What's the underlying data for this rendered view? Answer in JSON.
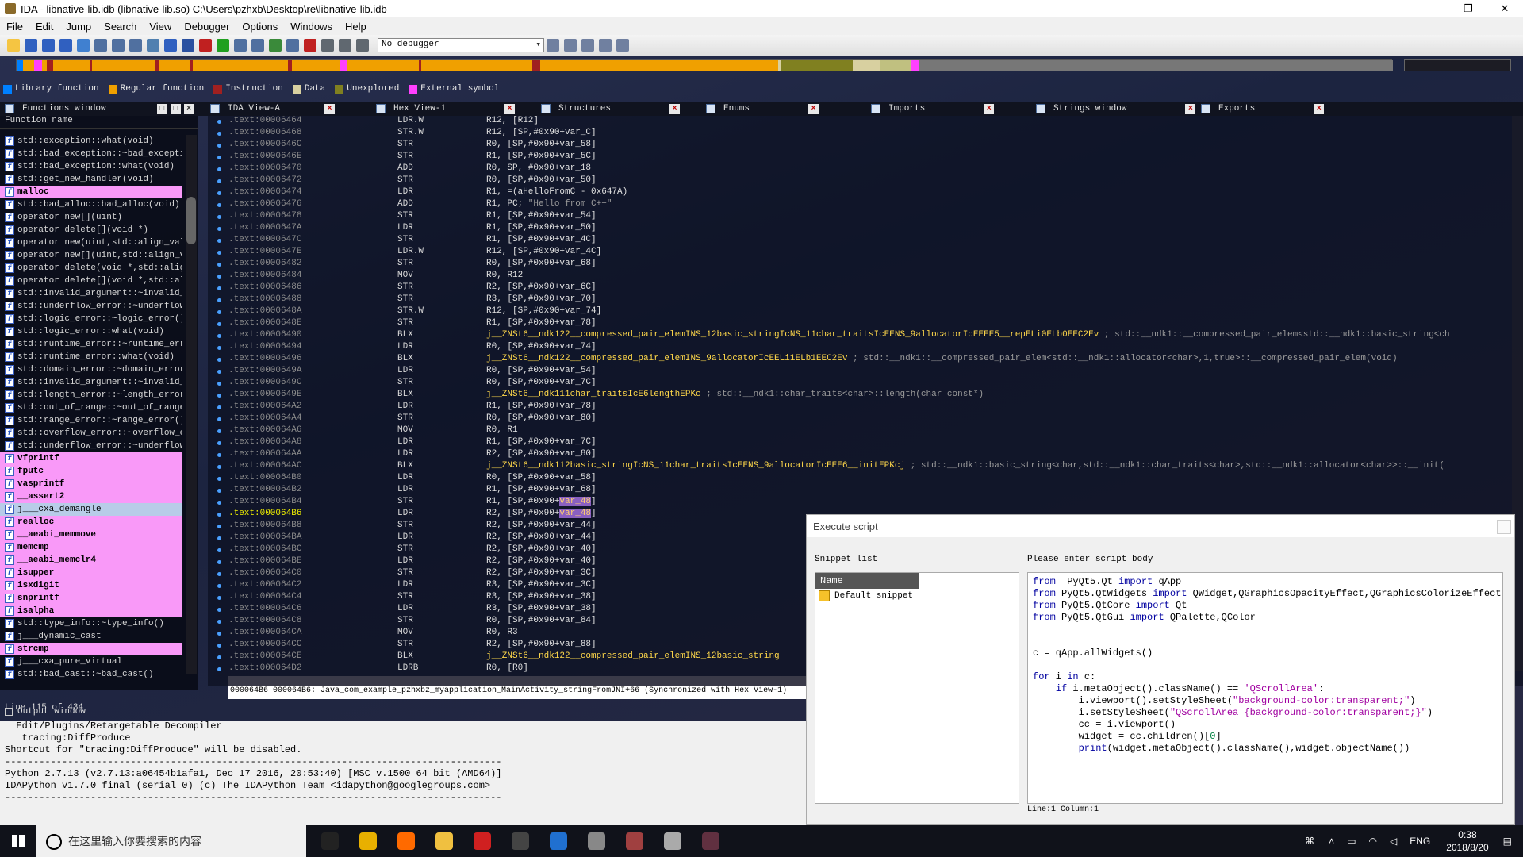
{
  "window": {
    "title": "IDA - libnative-lib.idb (libnative-lib.so) C:\\Users\\pzhxb\\Desktop\\re\\libnative-lib.idb",
    "min": "—",
    "max": "❐",
    "close": "✕"
  },
  "menu": [
    "File",
    "Edit",
    "Jump",
    "Search",
    "View",
    "Debugger",
    "Options",
    "Windows",
    "Help"
  ],
  "debugger_select": "No debugger",
  "legend": [
    {
      "label": "Library function",
      "color": "#0080ff"
    },
    {
      "label": "Regular function",
      "color": "#f0a000"
    },
    {
      "label": "Instruction",
      "color": "#a02020"
    },
    {
      "label": "Data",
      "color": "#d8d0a0"
    },
    {
      "label": "Unexplored",
      "color": "#808020"
    },
    {
      "label": "External symbol",
      "color": "#ff40ff"
    }
  ],
  "tabs": [
    {
      "label": "Functions window"
    },
    {
      "label": "IDA View-A"
    },
    {
      "label": "Hex View-1"
    },
    {
      "label": "Structures"
    },
    {
      "label": "Enums"
    },
    {
      "label": "Imports"
    },
    {
      "label": "Strings window"
    },
    {
      "label": "Exports"
    }
  ],
  "functions_window": {
    "header": "Function name",
    "rows": [
      {
        "name": "std::exception::what(void)",
        "style": ""
      },
      {
        "name": "std::bad_exception::~bad_exception",
        "style": ""
      },
      {
        "name": "std::bad_exception::what(void)",
        "style": ""
      },
      {
        "name": "std::get_new_handler(void)",
        "style": ""
      },
      {
        "name": "malloc",
        "style": "pink"
      },
      {
        "name": "std::bad_alloc::bad_alloc(void)",
        "style": ""
      },
      {
        "name": "operator new[](uint)",
        "style": ""
      },
      {
        "name": "operator delete[](void *)",
        "style": ""
      },
      {
        "name": "operator new(uint,std::align_val_t",
        "style": ""
      },
      {
        "name": "operator new[](uint,std::align_val",
        "style": ""
      },
      {
        "name": "operator delete(void *,std::align_",
        "style": ""
      },
      {
        "name": "operator delete[](void *,std::alig",
        "style": ""
      },
      {
        "name": "std::invalid_argument::~invalid_ar",
        "style": ""
      },
      {
        "name": "std::underflow_error::~underflow_e",
        "style": ""
      },
      {
        "name": "std::logic_error::~logic_error()",
        "style": ""
      },
      {
        "name": "std::logic_error::what(void)",
        "style": ""
      },
      {
        "name": "std::runtime_error::~runtime_error",
        "style": ""
      },
      {
        "name": "std::runtime_error::what(void)",
        "style": ""
      },
      {
        "name": "std::domain_error::~domain_error()",
        "style": ""
      },
      {
        "name": "std::invalid_argument::~invalid_ar",
        "style": ""
      },
      {
        "name": "std::length_error::~length_error()",
        "style": ""
      },
      {
        "name": "std::out_of_range::~out_of_range()",
        "style": ""
      },
      {
        "name": "std::range_error::~range_error()",
        "style": ""
      },
      {
        "name": "std::overflow_error::~overflow_err",
        "style": ""
      },
      {
        "name": "std::underflow_error::~underflow_e",
        "style": ""
      },
      {
        "name": "vfprintf",
        "style": "pink"
      },
      {
        "name": "fputc",
        "style": "pink"
      },
      {
        "name": "vasprintf",
        "style": "pink"
      },
      {
        "name": "__assert2",
        "style": "pink"
      },
      {
        "name": "j___cxa_demangle",
        "style": "sel"
      },
      {
        "name": "realloc",
        "style": "pink"
      },
      {
        "name": "__aeabi_memmove",
        "style": "pink"
      },
      {
        "name": "memcmp",
        "style": "pink"
      },
      {
        "name": "__aeabi_memclr4",
        "style": "pink"
      },
      {
        "name": "isupper",
        "style": "pink"
      },
      {
        "name": "isxdigit",
        "style": "pink"
      },
      {
        "name": "snprintf",
        "style": "pink"
      },
      {
        "name": "isalpha",
        "style": "pink"
      },
      {
        "name": "std::type_info::~type_info()",
        "style": ""
      },
      {
        "name": "j___dynamic_cast",
        "style": ""
      },
      {
        "name": "strcmp",
        "style": "pink"
      },
      {
        "name": "j___cxa_pure_virtual",
        "style": ""
      },
      {
        "name": "std::bad_cast::~bad_cast()",
        "style": ""
      }
    ],
    "footer": "Line 115 of 434"
  },
  "disasm": [
    {
      "addr": ".text:00006464",
      "mn": "LDR.W",
      "ops": "R12, [R12]"
    },
    {
      "addr": ".text:00006468",
      "mn": "STR.W",
      "ops": "R12, [SP,#0x90+var_C]"
    },
    {
      "addr": ".text:0000646C",
      "mn": "STR",
      "ops": "R0, [SP,#0x90+var_58]"
    },
    {
      "addr": ".text:0000646E",
      "mn": "STR",
      "ops": "R1, [SP,#0x90+var_5C]"
    },
    {
      "addr": ".text:00006470",
      "mn": "ADD",
      "ops": "R0, SP, #0x90+var_18"
    },
    {
      "addr": ".text:00006472",
      "mn": "STR",
      "ops": "R0, [SP,#0x90+var_50]"
    },
    {
      "addr": ".text:00006474",
      "mn": "LDR",
      "ops": "R1, =(aHelloFromC - 0x647A)"
    },
    {
      "addr": ".text:00006476",
      "mn": "ADD",
      "ops": "R1, PC",
      "cm": "; \"Hello from C++\""
    },
    {
      "addr": ".text:00006478",
      "mn": "STR",
      "ops": "R1, [SP,#0x90+var_54]"
    },
    {
      "addr": ".text:0000647A",
      "mn": "LDR",
      "ops": "R1, [SP,#0x90+var_50]"
    },
    {
      "addr": ".text:0000647C",
      "mn": "STR",
      "ops": "R1, [SP,#0x90+var_4C]"
    },
    {
      "addr": ".text:0000647E",
      "mn": "LDR.W",
      "ops": "R12, [SP,#0x90+var_4C]"
    },
    {
      "addr": ".text:00006482",
      "mn": "STR",
      "ops": "R0, [SP,#0x90+var_68]"
    },
    {
      "addr": ".text:00006484",
      "mn": "MOV",
      "ops": "R0, R12"
    },
    {
      "addr": ".text:00006486",
      "mn": "STR",
      "ops": "R2, [SP,#0x90+var_6C]"
    },
    {
      "addr": ".text:00006488",
      "mn": "STR",
      "ops": "R3, [SP,#0x90+var_70]"
    },
    {
      "addr": ".text:0000648A",
      "mn": "STR.W",
      "ops": "R12, [SP,#0x90+var_74]"
    },
    {
      "addr": ".text:0000648E",
      "mn": "STR",
      "ops": "R1, [SP,#0x90+var_78]"
    },
    {
      "addr": ".text:00006490",
      "mn": "BLX",
      "fn": "j__ZNSt6__ndk122__compressed_pair_elemINS_12basic_stringIcNS_11char_traitsIcEENS_9allocatorIcEEEE5__repELi0ELb0EEC2Ev",
      "cm": " ; std::__ndk1::__compressed_pair_elem<std::__ndk1::basic_string<ch"
    },
    {
      "addr": ".text:00006494",
      "mn": "LDR",
      "ops": "R0, [SP,#0x90+var_74]"
    },
    {
      "addr": ".text:00006496",
      "mn": "BLX",
      "fn": "j__ZNSt6__ndk122__compressed_pair_elemINS_9allocatorIcEELi1ELb1EEC2Ev",
      "cm": " ; std::__ndk1::__compressed_pair_elem<std::__ndk1::allocator<char>,1,true>::__compressed_pair_elem(void)"
    },
    {
      "addr": ".text:0000649A",
      "mn": "LDR",
      "ops": "R0, [SP,#0x90+var_54]"
    },
    {
      "addr": ".text:0000649C",
      "mn": "STR",
      "ops": "R0, [SP,#0x90+var_7C]"
    },
    {
      "addr": ".text:0000649E",
      "mn": "BLX",
      "fn": "j__ZNSt6__ndk111char_traitsIcE6lengthEPKc",
      "cm": " ; std::__ndk1::char_traits<char>::length(char const*)"
    },
    {
      "addr": ".text:000064A2",
      "mn": "LDR",
      "ops": "R1, [SP,#0x90+var_78]"
    },
    {
      "addr": ".text:000064A4",
      "mn": "STR",
      "ops": "R0, [SP,#0x90+var_80]"
    },
    {
      "addr": ".text:000064A6",
      "mn": "MOV",
      "ops": "R0, R1"
    },
    {
      "addr": ".text:000064A8",
      "mn": "LDR",
      "ops": "R1, [SP,#0x90+var_7C]"
    },
    {
      "addr": ".text:000064AA",
      "mn": "LDR",
      "ops": "R2, [SP,#0x90+var_80]"
    },
    {
      "addr": ".text:000064AC",
      "mn": "BLX",
      "fn": "j__ZNSt6__ndk112basic_stringIcNS_11char_traitsIcEENS_9allocatorIcEEE6__initEPKcj",
      "cm": " ; std::__ndk1::basic_string<char,std::__ndk1::char_traits<char>,std::__ndk1::allocator<char>>::__init("
    },
    {
      "addr": ".text:000064B0",
      "mn": "LDR",
      "ops": "R0, [SP,#0x90+var_58]"
    },
    {
      "addr": ".text:000064B2",
      "mn": "LDR",
      "ops": "R1, [SP,#0x90+var_68]"
    },
    {
      "addr": ".text:000064B4",
      "mn": "STR",
      "ops": "R1, [SP,#0x90+",
      "hl": "var_48",
      "post": "]"
    },
    {
      "addr": ".text:000064B6",
      "mn": "LDR",
      "ops": "R2, [SP,#0x90+",
      "hl": "var_48",
      "post": "]",
      "cur": true
    },
    {
      "addr": ".text:000064B8",
      "mn": "STR",
      "ops": "R2, [SP,#0x90+var_44]"
    },
    {
      "addr": ".text:000064BA",
      "mn": "LDR",
      "ops": "R2, [SP,#0x90+var_44]"
    },
    {
      "addr": ".text:000064BC",
      "mn": "STR",
      "ops": "R2, [SP,#0x90+var_40]"
    },
    {
      "addr": ".text:000064BE",
      "mn": "LDR",
      "ops": "R2, [SP,#0x90+var_40]"
    },
    {
      "addr": ".text:000064C0",
      "mn": "STR",
      "ops": "R2, [SP,#0x90+var_3C]"
    },
    {
      "addr": ".text:000064C2",
      "mn": "LDR",
      "ops": "R3, [SP,#0x90+var_3C]"
    },
    {
      "addr": ".text:000064C4",
      "mn": "STR",
      "ops": "R3, [SP,#0x90+var_38]"
    },
    {
      "addr": ".text:000064C6",
      "mn": "LDR",
      "ops": "R3, [SP,#0x90+var_38]"
    },
    {
      "addr": ".text:000064C8",
      "mn": "STR",
      "ops": "R0, [SP,#0x90+var_84]"
    },
    {
      "addr": ".text:000064CA",
      "mn": "MOV",
      "ops": "R0, R3"
    },
    {
      "addr": ".text:000064CC",
      "mn": "STR",
      "ops": "R2, [SP,#0x90+var_88]"
    },
    {
      "addr": ".text:000064CE",
      "mn": "BLX",
      "fn": "j__ZNSt6__ndk122__compressed_pair_elemINS_12basic_string"
    },
    {
      "addr": ".text:000064D2",
      "mn": "LDRB",
      "ops": "R0, [R0]"
    }
  ],
  "status_line": "000064B6 000064B6: Java_com_example_pzhxbz_myapplication_MainActivity_stringFromJNI+66 (Synchronized with Hex View-1)",
  "output": {
    "title": "Output window",
    "lines": [
      "  Edit/Plugins/Retargetable Decompiler",
      "   tracing:DiffProduce",
      "Shortcut for \"tracing:DiffProduce\" will be disabled.",
      "---------------------------------------------------------------------------------------",
      "Python 2.7.13 (v2.7.13:a06454b1afa1, Dec 17 2016, 20:53:40) [MSC v.1500 64 bit (AMD64)]",
      "IDAPython v1.7.0 final (serial 0) (c) The IDAPython Team <idapython@googlegroups.com>",
      "---------------------------------------------------------------------------------------"
    ]
  },
  "script_dialog": {
    "title": "Execute script",
    "snippet_label": "Snippet list",
    "name_header": "Name",
    "snippet": "Default snippet",
    "body_label": "Please enter script body",
    "code": [
      [
        [
          "kw",
          "from"
        ],
        [
          "",
          "  PyQt5.Qt "
        ],
        [
          "kw",
          "import"
        ],
        [
          "",
          " qApp"
        ]
      ],
      [
        [
          "kw",
          "from"
        ],
        [
          "",
          " PyQt5.QtWidgets "
        ],
        [
          "kw",
          "import"
        ],
        [
          "",
          " QWidget,QGraphicsOpacityEffect,QGraphicsColorizeEffect"
        ]
      ],
      [
        [
          "kw",
          "from"
        ],
        [
          "",
          " PyQt5.QtCore "
        ],
        [
          "kw",
          "import"
        ],
        [
          "",
          " Qt"
        ]
      ],
      [
        [
          "kw",
          "from"
        ],
        [
          "",
          " PyQt5.QtGui "
        ],
        [
          "kw",
          "import"
        ],
        [
          "",
          " QPalette,QColor"
        ]
      ],
      [],
      [],
      [
        [
          "",
          "c = qApp.allWidgets()"
        ]
      ],
      [],
      [
        [
          "kw",
          "for"
        ],
        [
          "",
          " i "
        ],
        [
          "kw",
          "in"
        ],
        [
          "",
          " c:"
        ]
      ],
      [
        [
          "",
          "    "
        ],
        [
          "kw",
          "if"
        ],
        [
          "",
          " i.metaObject().className() == "
        ],
        [
          "st",
          "'QScrollArea'"
        ],
        [
          "",
          ":"
        ]
      ],
      [
        [
          "",
          "        i.viewport().setStyleSheet("
        ],
        [
          "st",
          "\"background-color:transparent;\""
        ],
        [
          "",
          ")"
        ]
      ],
      [
        [
          "",
          "        i.setStyleSheet("
        ],
        [
          "st",
          "\"QScrollArea {background-color:transparent;}\""
        ],
        [
          "",
          ")"
        ]
      ],
      [
        [
          "",
          "        cc = i.viewport()"
        ]
      ],
      [
        [
          "",
          "        widget = cc.children()["
        ],
        [
          "nm",
          "0"
        ],
        [
          "",
          "]"
        ]
      ],
      [
        [
          "",
          "        "
        ],
        [
          "kw",
          "print"
        ],
        [
          "",
          "(widget.metaObject().className(),widget.objectName())"
        ]
      ]
    ],
    "position": "Line:1  Column:1"
  },
  "taskbar": {
    "search_placeholder": "在这里输入你要搜索的内容",
    "time": "0:38",
    "date": "2018/8/20",
    "lang": "ENG"
  }
}
